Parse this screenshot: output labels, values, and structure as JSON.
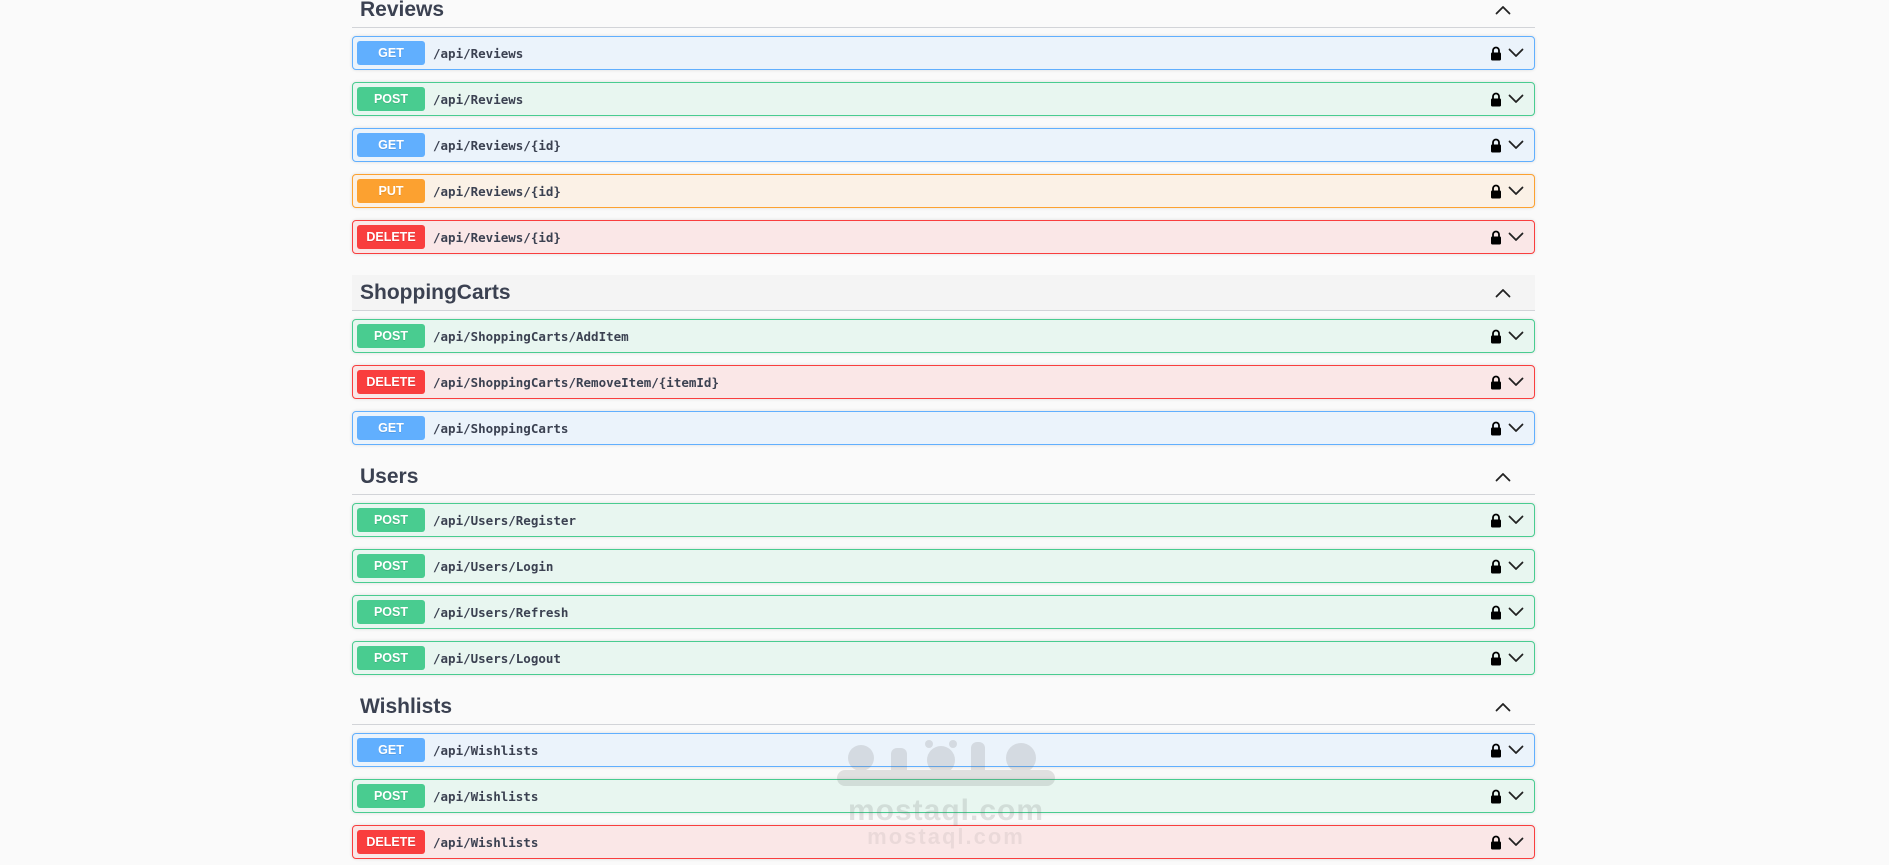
{
  "sections": [
    {
      "key": "reviews",
      "title": "Reviews",
      "hovered": false,
      "operations": [
        {
          "method": "GET",
          "path": "/api/Reviews"
        },
        {
          "method": "POST",
          "path": "/api/Reviews"
        },
        {
          "method": "GET",
          "path": "/api/Reviews/{id}"
        },
        {
          "method": "PUT",
          "path": "/api/Reviews/{id}"
        },
        {
          "method": "DELETE",
          "path": "/api/Reviews/{id}"
        }
      ]
    },
    {
      "key": "shoppingcarts",
      "title": "ShoppingCarts",
      "hovered": true,
      "operations": [
        {
          "method": "POST",
          "path": "/api/ShoppingCarts/AddItem"
        },
        {
          "method": "DELETE",
          "path": "/api/ShoppingCarts/RemoveItem/{itemId}"
        },
        {
          "method": "GET",
          "path": "/api/ShoppingCarts"
        }
      ]
    },
    {
      "key": "users",
      "title": "Users",
      "hovered": false,
      "operations": [
        {
          "method": "POST",
          "path": "/api/Users/Register"
        },
        {
          "method": "POST",
          "path": "/api/Users/Login"
        },
        {
          "method": "POST",
          "path": "/api/Users/Refresh"
        },
        {
          "method": "POST",
          "path": "/api/Users/Logout"
        }
      ]
    },
    {
      "key": "wishlists",
      "title": "Wishlists",
      "hovered": false,
      "operations": [
        {
          "method": "GET",
          "path": "/api/Wishlists"
        },
        {
          "method": "POST",
          "path": "/api/Wishlists"
        },
        {
          "method": "DELETE",
          "path": "/api/Wishlists"
        }
      ]
    }
  ],
  "icons": {
    "section_toggle": "chevron-up-icon",
    "operation_lock": "lock-icon",
    "operation_expand": "chevron-down-icon"
  },
  "colors": {
    "GET": "#61affe",
    "POST": "#49cc90",
    "PUT": "#fca130",
    "DELETE": "#f93e3e"
  },
  "watermark": {
    "logo_text": "مستقل",
    "text": "mostaql.com"
  }
}
